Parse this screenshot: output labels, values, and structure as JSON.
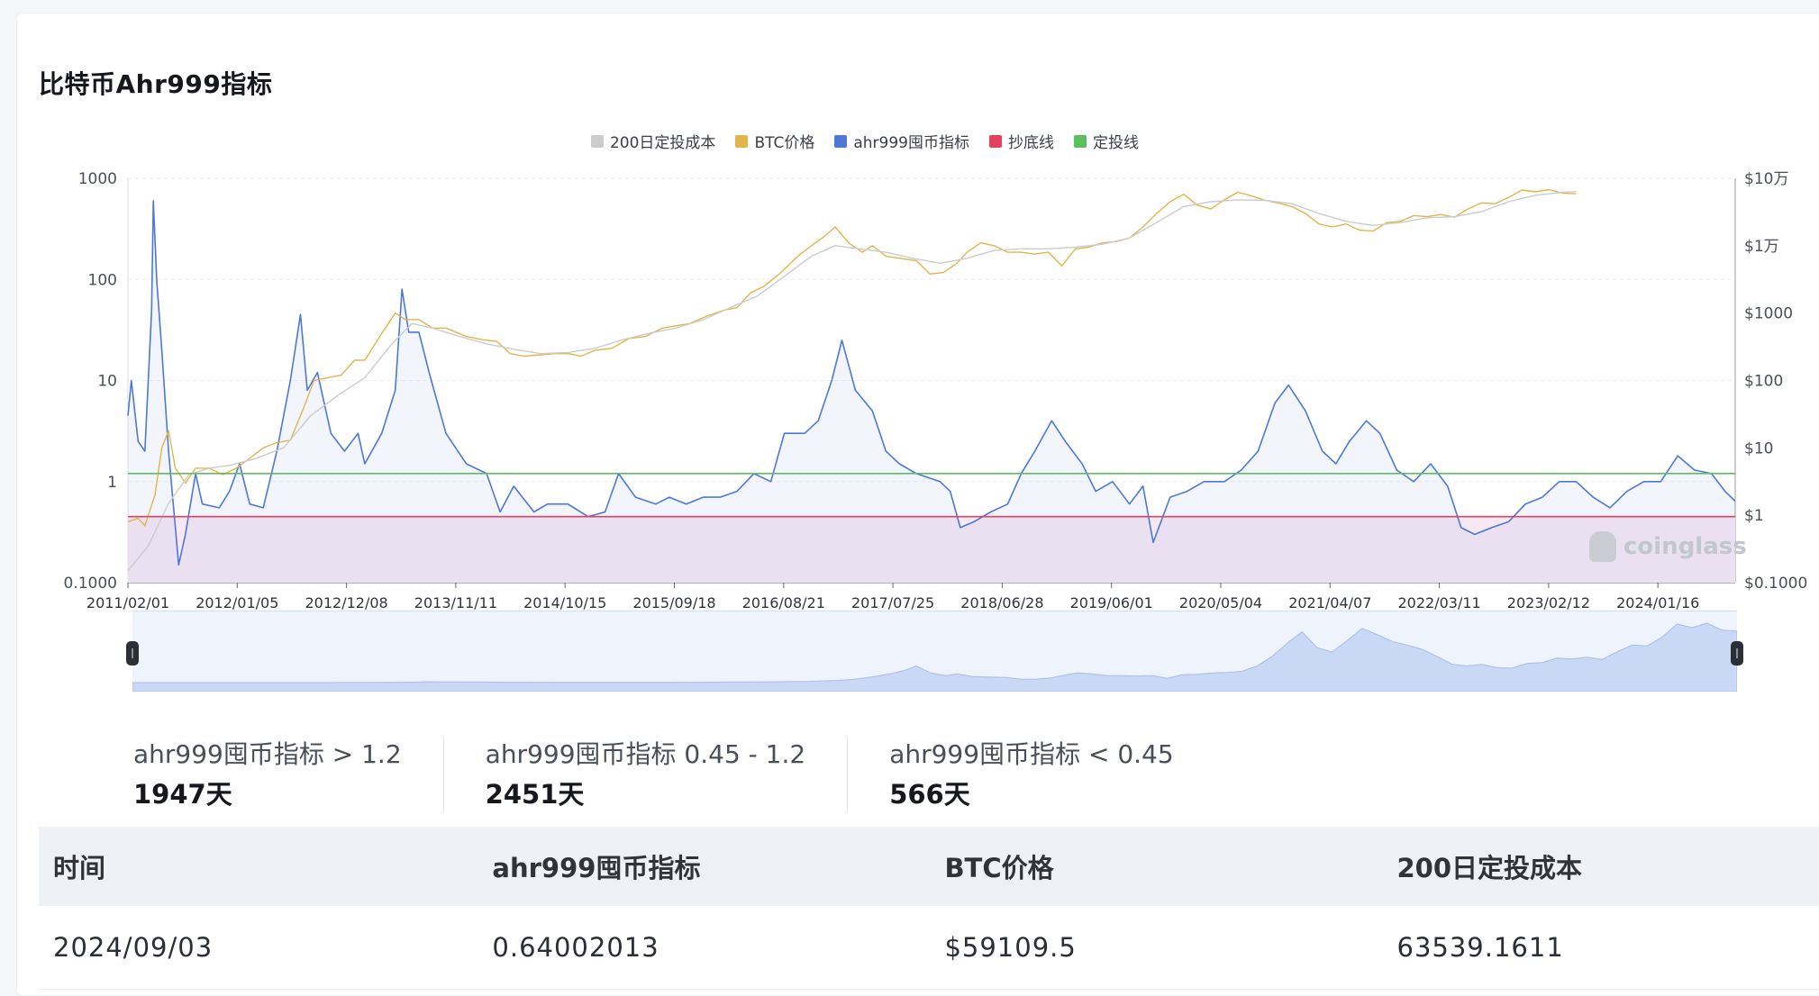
{
  "page": {
    "title": "比特币Ahr999指标"
  },
  "legend": [
    {
      "label": "200日定投成本",
      "color": "#cccccc"
    },
    {
      "label": "BTC价格",
      "color": "#e2b54c"
    },
    {
      "label": "ahr999囤币指标",
      "color": "#4d78d8"
    },
    {
      "label": "抄底线",
      "color": "#e3415d"
    },
    {
      "label": "定投线",
      "color": "#5cbe5c"
    }
  ],
  "stats": [
    {
      "label": "ahr999囤币指标 > 1.2",
      "value": "1947天"
    },
    {
      "label": "ahr999囤币指标 0.45 - 1.2",
      "value": "2451天"
    },
    {
      "label": "ahr999囤币指标 < 0.45",
      "value": "566天"
    }
  ],
  "table": {
    "headers": [
      "时间",
      "ahr999囤币指标",
      "BTC价格",
      "200日定投成本"
    ],
    "rows": [
      [
        "2024/09/03",
        "0.64002013",
        "$59109.5",
        "63539.1611"
      ]
    ]
  },
  "watermark": "coinglass",
  "chart_data": {
    "type": "line",
    "x_ticks": [
      "2011/02/01",
      "2012/01/05",
      "2012/12/08",
      "2013/11/11",
      "2014/10/15",
      "2015/09/18",
      "2016/08/21",
      "2017/07/25",
      "2018/06/28",
      "2019/06/01",
      "2020/05/04",
      "2021/04/07",
      "2022/03/11",
      "2023/02/12",
      "2024/01/16"
    ],
    "left_axis": {
      "scale": "log",
      "ticks": [
        "1000",
        "100",
        "10",
        "1",
        "0.1000"
      ],
      "range": [
        0.1,
        1000
      ]
    },
    "right_axis": {
      "scale": "log",
      "ticks": [
        "$10万",
        "$1万",
        "$1000",
        "$100",
        "$10",
        "$1",
        "$0.1000"
      ],
      "range": [
        0.1,
        100000
      ]
    },
    "reference_lines": [
      {
        "name": "抄底线",
        "value": 0.45,
        "color": "#e3415d"
      },
      {
        "name": "定投线",
        "value": 1.2,
        "color": "#5cbe5c"
      }
    ],
    "series": [
      {
        "name": "ahr999囤币指标",
        "axis": "left",
        "color": "#4d78d8",
        "points": [
          [
            0,
            4.5
          ],
          [
            0.1,
            10
          ],
          [
            0.3,
            2.5
          ],
          [
            0.5,
            2
          ],
          [
            0.7,
            50
          ],
          [
            0.75,
            600
          ],
          [
            0.85,
            100
          ],
          [
            1.0,
            20
          ],
          [
            1.2,
            2
          ],
          [
            1.5,
            0.15
          ],
          [
            1.7,
            0.3
          ],
          [
            2.0,
            1.2
          ],
          [
            2.2,
            0.6
          ],
          [
            2.7,
            0.55
          ],
          [
            3.0,
            0.8
          ],
          [
            3.3,
            1.5
          ],
          [
            3.6,
            0.6
          ],
          [
            4.0,
            0.55
          ],
          [
            4.4,
            2
          ],
          [
            4.8,
            10
          ],
          [
            5.1,
            45
          ],
          [
            5.3,
            8
          ],
          [
            5.6,
            12
          ],
          [
            6.0,
            3
          ],
          [
            6.4,
            2
          ],
          [
            6.8,
            3
          ],
          [
            7.0,
            1.5
          ],
          [
            7.5,
            3
          ],
          [
            7.9,
            8
          ],
          [
            8.1,
            80
          ],
          [
            8.3,
            30
          ],
          [
            8.6,
            30
          ],
          [
            8.9,
            12
          ],
          [
            9.4,
            3
          ],
          [
            10.0,
            1.5
          ],
          [
            10.6,
            1.2
          ],
          [
            11.0,
            0.5
          ],
          [
            11.4,
            0.9
          ],
          [
            12.0,
            0.5
          ],
          [
            12.4,
            0.6
          ],
          [
            13.0,
            0.6
          ],
          [
            13.6,
            0.45
          ],
          [
            14.1,
            0.5
          ],
          [
            14.5,
            1.2
          ],
          [
            15.0,
            0.7
          ],
          [
            15.6,
            0.6
          ],
          [
            16.0,
            0.7
          ],
          [
            16.5,
            0.6
          ],
          [
            17.0,
            0.7
          ],
          [
            17.5,
            0.7
          ],
          [
            18.0,
            0.8
          ],
          [
            18.5,
            1.2
          ],
          [
            19.0,
            1.0
          ],
          [
            19.4,
            3
          ],
          [
            20.0,
            3
          ],
          [
            20.4,
            4
          ],
          [
            20.8,
            10
          ],
          [
            21.1,
            25
          ],
          [
            21.5,
            8
          ],
          [
            22.0,
            5
          ],
          [
            22.4,
            2
          ],
          [
            22.8,
            1.5
          ],
          [
            23.3,
            1.2
          ],
          [
            24.0,
            1.0
          ],
          [
            24.3,
            0.8
          ],
          [
            24.6,
            0.35
          ],
          [
            25.0,
            0.4
          ],
          [
            25.5,
            0.5
          ],
          [
            26.0,
            0.6
          ],
          [
            26.4,
            1.2
          ],
          [
            26.8,
            2
          ],
          [
            27.3,
            4
          ],
          [
            27.7,
            2.5
          ],
          [
            28.2,
            1.5
          ],
          [
            28.6,
            0.8
          ],
          [
            29.1,
            1.0
          ],
          [
            29.6,
            0.6
          ],
          [
            30.0,
            0.9
          ],
          [
            30.3,
            0.25
          ],
          [
            30.8,
            0.7
          ],
          [
            31.3,
            0.8
          ],
          [
            31.8,
            1.0
          ],
          [
            32.4,
            1.0
          ],
          [
            32.9,
            1.3
          ],
          [
            33.4,
            2
          ],
          [
            33.9,
            6
          ],
          [
            34.3,
            9
          ],
          [
            34.8,
            5
          ],
          [
            35.3,
            2
          ],
          [
            35.7,
            1.5
          ],
          [
            36.1,
            2.5
          ],
          [
            36.6,
            4
          ],
          [
            37.0,
            3
          ],
          [
            37.5,
            1.3
          ],
          [
            38.0,
            1.0
          ],
          [
            38.5,
            1.5
          ],
          [
            39.0,
            0.9
          ],
          [
            39.4,
            0.35
          ],
          [
            39.8,
            0.3
          ],
          [
            40.3,
            0.35
          ],
          [
            40.8,
            0.4
          ],
          [
            41.3,
            0.6
          ],
          [
            41.8,
            0.7
          ],
          [
            42.3,
            1.0
          ],
          [
            42.8,
            1.0
          ],
          [
            43.3,
            0.7
          ],
          [
            43.8,
            0.55
          ],
          [
            44.3,
            0.8
          ],
          [
            44.8,
            1.0
          ],
          [
            45.3,
            1.0
          ],
          [
            45.8,
            1.8
          ],
          [
            46.3,
            1.3
          ],
          [
            46.8,
            1.2
          ],
          [
            47.2,
            0.8
          ],
          [
            47.5,
            0.64
          ]
        ]
      },
      {
        "name": "BTC价格",
        "axis": "right",
        "color": "#e2b54c",
        "points": [
          [
            0,
            0.8
          ],
          [
            0.3,
            0.9
          ],
          [
            0.5,
            0.7
          ],
          [
            0.8,
            2
          ],
          [
            1.0,
            10
          ],
          [
            1.2,
            18
          ],
          [
            1.4,
            5
          ],
          [
            1.7,
            3
          ],
          [
            2.0,
            5
          ],
          [
            2.4,
            5
          ],
          [
            2.8,
            4
          ],
          [
            3.2,
            5
          ],
          [
            3.6,
            7
          ],
          [
            4.0,
            10
          ],
          [
            4.4,
            12
          ],
          [
            4.8,
            13
          ],
          [
            5.2,
            40
          ],
          [
            5.5,
            100
          ],
          [
            5.9,
            110
          ],
          [
            6.3,
            120
          ],
          [
            6.7,
            200
          ],
          [
            7.0,
            200
          ],
          [
            7.5,
            500
          ],
          [
            7.9,
            1000
          ],
          [
            8.2,
            800
          ],
          [
            8.6,
            800
          ],
          [
            9.0,
            600
          ],
          [
            9.4,
            600
          ],
          [
            10.0,
            450
          ],
          [
            10.5,
            400
          ],
          [
            10.9,
            380
          ],
          [
            11.3,
            250
          ],
          [
            11.7,
            230
          ],
          [
            12.2,
            240
          ],
          [
            12.6,
            250
          ],
          [
            13.0,
            250
          ],
          [
            13.4,
            230
          ],
          [
            13.8,
            280
          ],
          [
            14.3,
            300
          ],
          [
            14.8,
            420
          ],
          [
            15.3,
            450
          ],
          [
            15.8,
            600
          ],
          [
            16.2,
            650
          ],
          [
            16.6,
            700
          ],
          [
            17.1,
            900
          ],
          [
            17.6,
            1100
          ],
          [
            18.0,
            1200
          ],
          [
            18.4,
            2000
          ],
          [
            18.8,
            2500
          ],
          [
            19.3,
            4000
          ],
          [
            19.8,
            7000
          ],
          [
            20.2,
            10000
          ],
          [
            20.6,
            14000
          ],
          [
            20.9,
            19000
          ],
          [
            21.3,
            11000
          ],
          [
            21.7,
            8000
          ],
          [
            22.0,
            10000
          ],
          [
            22.4,
            7000
          ],
          [
            22.8,
            6500
          ],
          [
            23.3,
            6000
          ],
          [
            23.7,
            3800
          ],
          [
            24.1,
            4000
          ],
          [
            24.5,
            5500
          ],
          [
            24.8,
            8000
          ],
          [
            25.2,
            11000
          ],
          [
            25.6,
            10000
          ],
          [
            26.0,
            8000
          ],
          [
            26.4,
            8000
          ],
          [
            26.8,
            7500
          ],
          [
            27.2,
            8000
          ],
          [
            27.6,
            5000
          ],
          [
            28.0,
            9000
          ],
          [
            28.4,
            9500
          ],
          [
            28.8,
            11000
          ],
          [
            29.2,
            11500
          ],
          [
            29.6,
            13000
          ],
          [
            30.0,
            19000
          ],
          [
            30.4,
            30000
          ],
          [
            30.8,
            45000
          ],
          [
            31.2,
            58000
          ],
          [
            31.6,
            40000
          ],
          [
            32.0,
            35000
          ],
          [
            32.4,
            48000
          ],
          [
            32.8,
            62000
          ],
          [
            33.2,
            55000
          ],
          [
            33.6,
            47000
          ],
          [
            34.0,
            43000
          ],
          [
            34.4,
            38000
          ],
          [
            34.8,
            30000
          ],
          [
            35.2,
            21000
          ],
          [
            35.6,
            19000
          ],
          [
            36.0,
            21000
          ],
          [
            36.4,
            17000
          ],
          [
            36.8,
            16500
          ],
          [
            37.2,
            22000
          ],
          [
            37.6,
            23000
          ],
          [
            38.0,
            28000
          ],
          [
            38.4,
            27000
          ],
          [
            38.8,
            29000
          ],
          [
            39.2,
            26500
          ],
          [
            39.6,
            35000
          ],
          [
            40.0,
            43000
          ],
          [
            40.4,
            42000
          ],
          [
            40.8,
            52000
          ],
          [
            41.2,
            67000
          ],
          [
            41.6,
            63000
          ],
          [
            42.0,
            68000
          ],
          [
            42.4,
            60000
          ],
          [
            42.8,
            59000
          ]
        ]
      },
      {
        "name": "200日定投成本",
        "axis": "right",
        "color": "#cccccc",
        "points": [
          [
            0,
            0.15
          ],
          [
            0.6,
            0.35
          ],
          [
            1.2,
            1.5
          ],
          [
            1.8,
            4
          ],
          [
            2.4,
            5
          ],
          [
            3.0,
            5.5
          ],
          [
            3.8,
            7
          ],
          [
            4.6,
            10
          ],
          [
            5.4,
            30
          ],
          [
            6.2,
            60
          ],
          [
            7.0,
            110
          ],
          [
            7.8,
            350
          ],
          [
            8.4,
            700
          ],
          [
            9.0,
            600
          ],
          [
            9.8,
            450
          ],
          [
            10.6,
            350
          ],
          [
            11.4,
            290
          ],
          [
            12.2,
            250
          ],
          [
            13.0,
            260
          ],
          [
            13.8,
            300
          ],
          [
            14.6,
            400
          ],
          [
            15.4,
            500
          ],
          [
            16.2,
            600
          ],
          [
            17.0,
            800
          ],
          [
            17.8,
            1200
          ],
          [
            18.6,
            1800
          ],
          [
            19.4,
            3500
          ],
          [
            20.2,
            7000
          ],
          [
            20.9,
            10000
          ],
          [
            21.6,
            9000
          ],
          [
            22.4,
            8000
          ],
          [
            23.2,
            6500
          ],
          [
            24.0,
            5500
          ],
          [
            24.8,
            6500
          ],
          [
            25.6,
            8500
          ],
          [
            26.4,
            9000
          ],
          [
            27.2,
            9000
          ],
          [
            28.0,
            9500
          ],
          [
            28.8,
            10500
          ],
          [
            29.6,
            13000
          ],
          [
            30.4,
            22000
          ],
          [
            31.2,
            38000
          ],
          [
            32.0,
            45000
          ],
          [
            32.8,
            48000
          ],
          [
            33.6,
            47000
          ],
          [
            34.4,
            42000
          ],
          [
            35.2,
            30000
          ],
          [
            36.0,
            23000
          ],
          [
            36.8,
            20000
          ],
          [
            37.6,
            22000
          ],
          [
            38.4,
            26000
          ],
          [
            39.2,
            27000
          ],
          [
            40.0,
            32000
          ],
          [
            40.8,
            45000
          ],
          [
            41.6,
            56000
          ],
          [
            42.4,
            62000
          ],
          [
            42.8,
            63500
          ]
        ]
      }
    ]
  }
}
